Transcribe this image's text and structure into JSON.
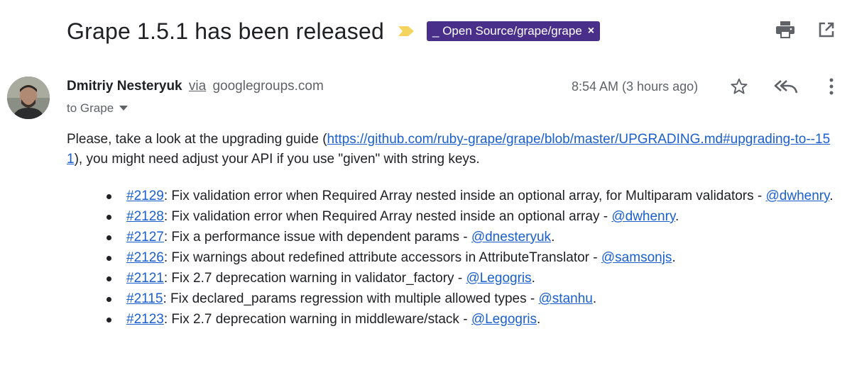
{
  "subject": "Grape 1.5.1 has been released",
  "label": {
    "text": "_ Open Source/grape/grape",
    "remove": "×"
  },
  "sender": {
    "name": "Dmitriy Nesteryuk",
    "via": "via",
    "domain": "googlegroups.com"
  },
  "recipient": "to Grape",
  "time": "8:54 AM (3 hours ago)",
  "intro": {
    "before": "Please, take a look at the upgrading guide (",
    "link": "https://github.com/ruby-grape/grape/blob/master/UPGRADING.md#upgrading-to--151",
    "after": "), you might need adjust your API if you use \"given\" with string keys."
  },
  "changes": [
    {
      "pr": "#2129",
      "text": ": Fix validation error when Required Array nested inside an optional array, for Multiparam validators - ",
      "author": "@dwhenry",
      "end": "."
    },
    {
      "pr": "#2128",
      "text": ": Fix validation error when Required Array nested inside an optional array - ",
      "author": "@dwhenry",
      "end": "."
    },
    {
      "pr": "#2127",
      "text": ": Fix a performance issue with dependent params - ",
      "author": "@dnesteryuk",
      "end": "."
    },
    {
      "pr": "#2126",
      "text": ": Fix warnings about redefined attribute accessors in AttributeTranslator - ",
      "author": "@samsonjs",
      "end": "."
    },
    {
      "pr": "#2121",
      "text": ": Fix 2.7 deprecation warning in validator_factory - ",
      "author": "@Legogris",
      "end": "."
    },
    {
      "pr": "#2115",
      "text": ": Fix declared_params regression with multiple allowed types - ",
      "author": "@stanhu",
      "end": "."
    },
    {
      "pr": "#2123",
      "text": ": Fix 2.7 deprecation warning in middleware/stack - ",
      "author": "@Legogris",
      "end": "."
    }
  ],
  "icons": {
    "importance": "importance-marker-icon",
    "print": "print-icon",
    "open_new_window": "open-in-new-window-icon",
    "star": "star-icon",
    "reply_all": "reply-all-icon",
    "more": "more-vertical-icon",
    "recipient_details": "chevron-down-icon"
  },
  "colors": {
    "label_bg": "#4a2f8a",
    "importance": "#f4d45e",
    "link": "#1a5fd0",
    "muted": "#5f6368"
  }
}
